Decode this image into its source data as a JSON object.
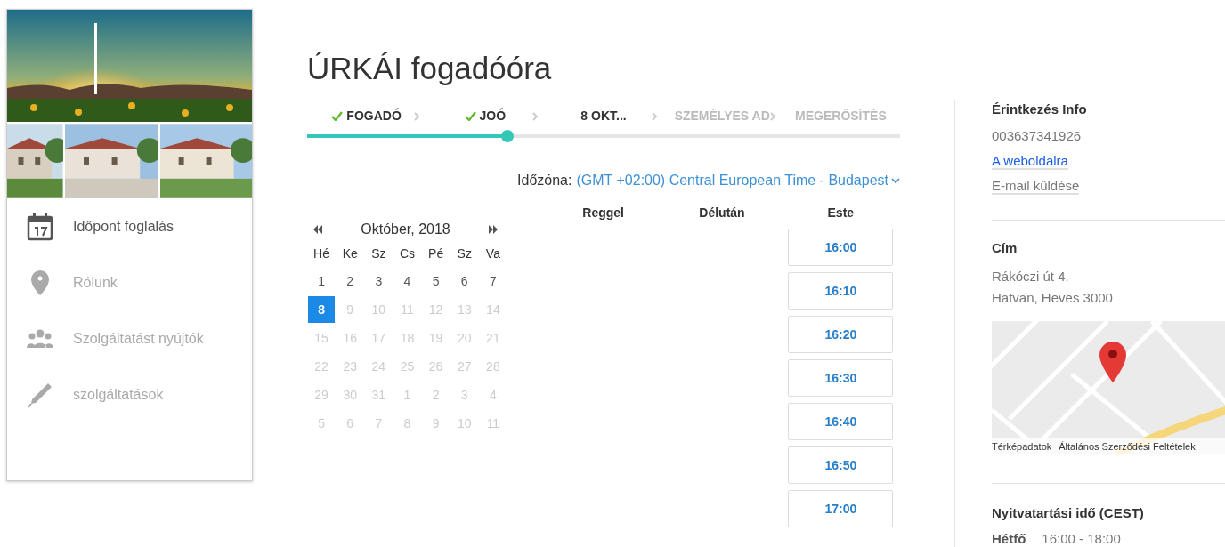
{
  "sidebar": {
    "items": [
      {
        "label": "Időpont foglalás",
        "selected": true
      },
      {
        "label": "Rólunk",
        "selected": false
      },
      {
        "label": "Szolgáltatást nyújtók",
        "selected": false
      },
      {
        "label": "szolgáltatások",
        "selected": false
      }
    ]
  },
  "main": {
    "title": "ÚRKÁI fogadóóra",
    "steps": [
      {
        "label": "FOGADÓ",
        "done": true,
        "disabled": false
      },
      {
        "label": "JOÓ",
        "done": true,
        "disabled": false
      },
      {
        "label": "8 OKT...",
        "done": false,
        "disabled": false
      },
      {
        "label": "SZEMÉLYES AD",
        "done": false,
        "disabled": true
      },
      {
        "label": "MEGERŐSÍTÉS",
        "done": false,
        "disabled": true
      }
    ],
    "progress": {
      "level": 0.338
    },
    "timezone": {
      "label": "Időzóna:",
      "value": "(GMT +02:00) Central European Time - Budapest"
    },
    "calendar": {
      "month": "Október, 2018",
      "weekdays": [
        "Hé",
        "Ke",
        "Sz",
        "Cs",
        "Pé",
        "Sz",
        "Va"
      ],
      "weeks": [
        [
          {
            "d": "1",
            "disabled": false,
            "selected": false
          },
          {
            "d": "2",
            "disabled": false,
            "selected": false
          },
          {
            "d": "3",
            "disabled": false,
            "selected": false
          },
          {
            "d": "4",
            "disabled": false,
            "selected": false
          },
          {
            "d": "5",
            "disabled": false,
            "selected": false
          },
          {
            "d": "6",
            "disabled": false,
            "selected": false
          },
          {
            "d": "7",
            "disabled": false,
            "selected": false
          }
        ],
        [
          {
            "d": "8",
            "disabled": false,
            "selected": true
          },
          {
            "d": "9",
            "disabled": true,
            "selected": false
          },
          {
            "d": "10",
            "disabled": true,
            "selected": false
          },
          {
            "d": "11",
            "disabled": true,
            "selected": false
          },
          {
            "d": "12",
            "disabled": true,
            "selected": false
          },
          {
            "d": "13",
            "disabled": true,
            "selected": false
          },
          {
            "d": "14",
            "disabled": true,
            "selected": false
          }
        ],
        [
          {
            "d": "15",
            "disabled": true,
            "selected": false
          },
          {
            "d": "16",
            "disabled": true,
            "selected": false
          },
          {
            "d": "17",
            "disabled": true,
            "selected": false
          },
          {
            "d": "18",
            "disabled": true,
            "selected": false
          },
          {
            "d": "19",
            "disabled": true,
            "selected": false
          },
          {
            "d": "20",
            "disabled": true,
            "selected": false
          },
          {
            "d": "21",
            "disabled": true,
            "selected": false
          }
        ],
        [
          {
            "d": "22",
            "disabled": true,
            "selected": false
          },
          {
            "d": "23",
            "disabled": true,
            "selected": false
          },
          {
            "d": "24",
            "disabled": true,
            "selected": false
          },
          {
            "d": "25",
            "disabled": true,
            "selected": false
          },
          {
            "d": "26",
            "disabled": true,
            "selected": false
          },
          {
            "d": "27",
            "disabled": true,
            "selected": false
          },
          {
            "d": "28",
            "disabled": true,
            "selected": false
          }
        ],
        [
          {
            "d": "29",
            "disabled": true,
            "selected": false
          },
          {
            "d": "30",
            "disabled": true,
            "selected": false
          },
          {
            "d": "31",
            "disabled": true,
            "selected": false
          },
          {
            "d": "1",
            "disabled": true,
            "selected": false
          },
          {
            "d": "2",
            "disabled": true,
            "selected": false
          },
          {
            "d": "3",
            "disabled": true,
            "selected": false
          },
          {
            "d": "4",
            "disabled": true,
            "selected": false
          }
        ],
        [
          {
            "d": "5",
            "disabled": true,
            "selected": false
          },
          {
            "d": "6",
            "disabled": true,
            "selected": false
          },
          {
            "d": "7",
            "disabled": true,
            "selected": false
          },
          {
            "d": "8",
            "disabled": true,
            "selected": false
          },
          {
            "d": "9",
            "disabled": true,
            "selected": false
          },
          {
            "d": "10",
            "disabled": true,
            "selected": false
          },
          {
            "d": "11",
            "disabled": true,
            "selected": false
          }
        ]
      ]
    },
    "slot_columns": [
      {
        "label": "Reggel"
      },
      {
        "label": "Délután"
      },
      {
        "label": "Este",
        "slots": [
          "16:00",
          "16:10",
          "16:20",
          "16:30",
          "16:40",
          "16:50",
          "17:00"
        ]
      }
    ]
  },
  "info": {
    "contact": {
      "heading": "Érintkezés Info",
      "phone": "003637341926",
      "website": "A weboldalra",
      "email": "E-mail küldése"
    },
    "address": {
      "heading": "Cím",
      "lines": [
        "Rákóczi út 4.",
        "Hatvan, Heves 3000"
      ]
    },
    "map": {
      "kind": "picture",
      "attribution": [
        "Térképadatok",
        "Általános Szerződési Feltételek"
      ]
    },
    "hours": {
      "heading": "Nyitvatartási idő (CEST)",
      "rows": [
        {
          "day": "Hétfő",
          "time": "16:00 - 18:00"
        }
      ]
    }
  }
}
